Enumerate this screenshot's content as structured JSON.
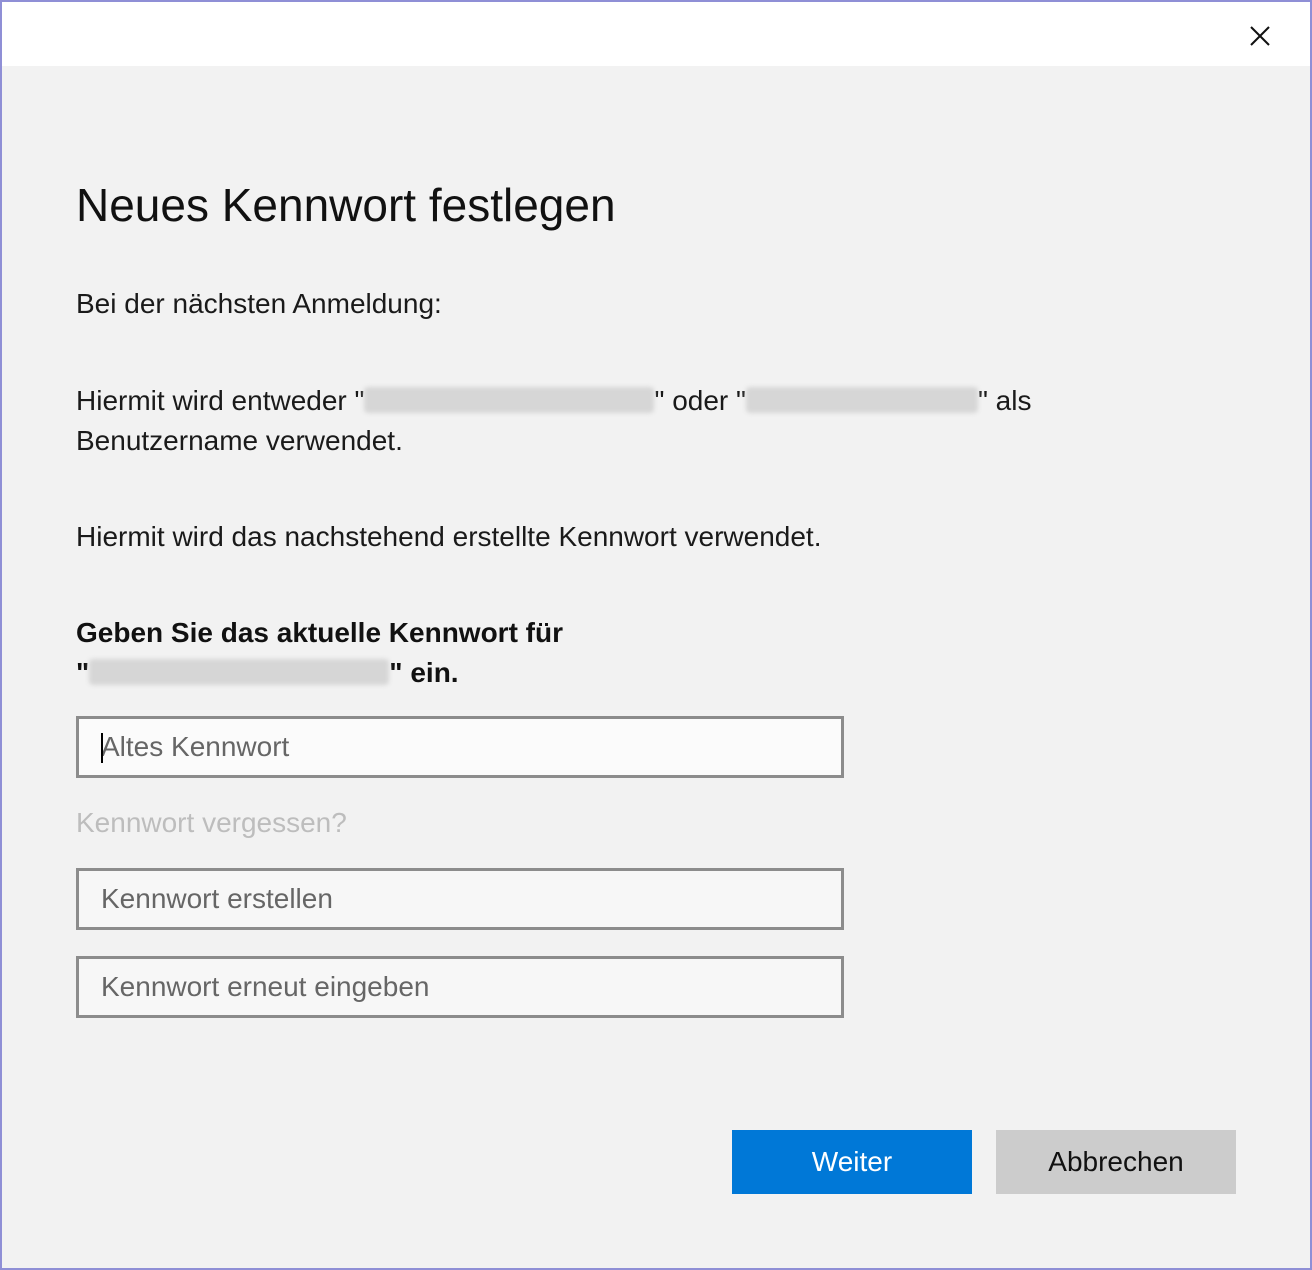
{
  "dialog": {
    "title": "Neues Kennwort festlegen",
    "next_login_text": "Bei der nächsten Anmeldung:",
    "username_text_1": "Hiermit wird entweder \"",
    "username_text_2": "\" oder \"",
    "username_text_3": "\" als",
    "username_text_4": "Benutzername verwendet.",
    "password_text": "Hiermit wird das nachstehend erstellte Kennwort verwendet.",
    "prompt_line1": "Geben Sie das aktuelle Kennwort für",
    "prompt_line2_start": "\"",
    "prompt_line2_end": "\" ein.",
    "old_password_placeholder": "Altes Kennwort",
    "forgot_link": "Kennwort vergessen?",
    "new_password_placeholder": "Kennwort erstellen",
    "confirm_password_placeholder": "Kennwort erneut eingeben",
    "next_button": "Weiter",
    "cancel_button": "Abbrechen"
  },
  "icons": {
    "close": "close-icon"
  },
  "colors": {
    "primary": "#0078d7",
    "secondary_button": "#cccccc",
    "background": "#f2f2f2",
    "border_accent": "#8f8fd6",
    "link_disabled": "#bdbdbd"
  }
}
